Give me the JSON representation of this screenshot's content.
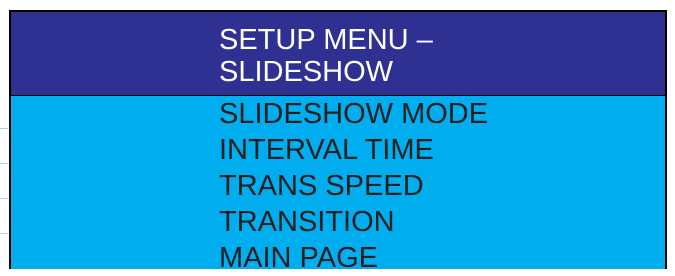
{
  "colors": {
    "header_background": "#2e3192",
    "body_background": "#00aeef",
    "frame_border": "#000000",
    "header_text": "#ffffff",
    "item_text": "#231f20"
  },
  "menu": {
    "title_line1": "SETUP MENU –",
    "title_line2": "SLIDESHOW",
    "items": [
      {
        "label": "SLIDESHOW MODE"
      },
      {
        "label": "INTERVAL TIME"
      },
      {
        "label": "TRANS SPEED"
      },
      {
        "label": "TRANSITION"
      },
      {
        "label": "MAIN PAGE"
      }
    ]
  }
}
